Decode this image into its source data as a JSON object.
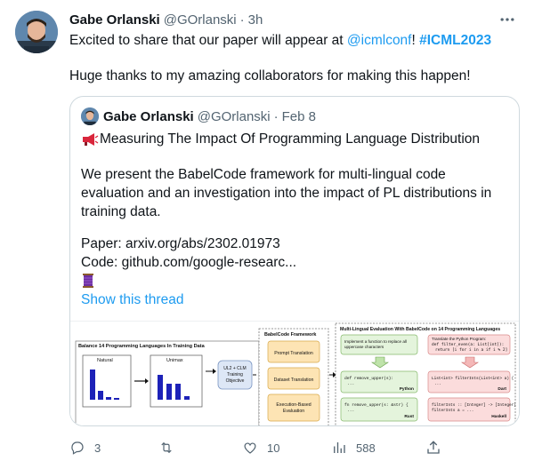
{
  "tweet": {
    "author_name": "Gabe Orlanski",
    "author_handle": "@GOrlanski",
    "time": "3h",
    "line1_prefix": "Excited to share that our paper will appear at ",
    "line1_mention": "@icmlconf",
    "line1_bang": "!",
    "line1_hashtag": "#ICML2023",
    "line2": "Huge thanks to my amazing collaborators for making this happen!"
  },
  "quote": {
    "author_name": "Gabe Orlanski",
    "author_handle": "@GOrlanski",
    "date": "Feb 8",
    "title": "Measuring The Impact Of Programming Language Distribution",
    "para": [
      "We present the BabelCode framework for multi-lingual code",
      "evaluation and an investigation into the impact of PL distributions in",
      "training data."
    ],
    "paper_line": "Paper: arxiv.org/abs/2302.01973",
    "code_line": "Code: github.com/google-researc...",
    "show_thread": "Show this thread"
  },
  "figure": {
    "panel1_title": "Balance 14 Programming Languages In Training Data",
    "natural_label": "Natural",
    "unimax_label": "Unimax",
    "objective_label": [
      "UL2 + CLM",
      "Training",
      "Objective"
    ],
    "framework_title": "BabelCode Framework",
    "prompt_translation": "Prompt Translation",
    "dataset_translation": "Dataset Translation",
    "execution_eval": [
      "Execution-Based",
      "Evaluation"
    ],
    "eval_title": "Multi-Lingual Evaluation With BabelCode on 14 Programming Languages",
    "task_left": [
      "Implement a function to replace all",
      "uppercase characters"
    ],
    "task_right": [
      "Translate the Python Program:",
      "def filter_even(a: List[int]):",
      "return [i for i in a if i % 2]"
    ],
    "py_code": [
      "def remove_upper(s):",
      "..."
    ],
    "py_lang": "Python",
    "dart_code": [
      "List<int> filterInts(List<int> a) {",
      "..."
    ],
    "dart_lang": "Dart",
    "rust_code": [
      "fn remove_upper(s: &str) {",
      "..."
    ],
    "rust_lang": "Rust",
    "hs_code": [
      "filterInts :: [Integer] -> [Integer]",
      "filterInts a = ..."
    ],
    "hs_lang": "Haskell"
  },
  "actions": {
    "replies": "3",
    "retweets": "",
    "likes": "10",
    "views": "588"
  },
  "colors": {
    "link": "#1d9bf0",
    "muted": "#536471",
    "border": "#cfd9de",
    "bar": "#1d22b8",
    "orange_box": "#fde4b4",
    "green_box": "#e4f4dc",
    "red_box": "#fbdcdc",
    "blue_box": "#dde7f6"
  }
}
